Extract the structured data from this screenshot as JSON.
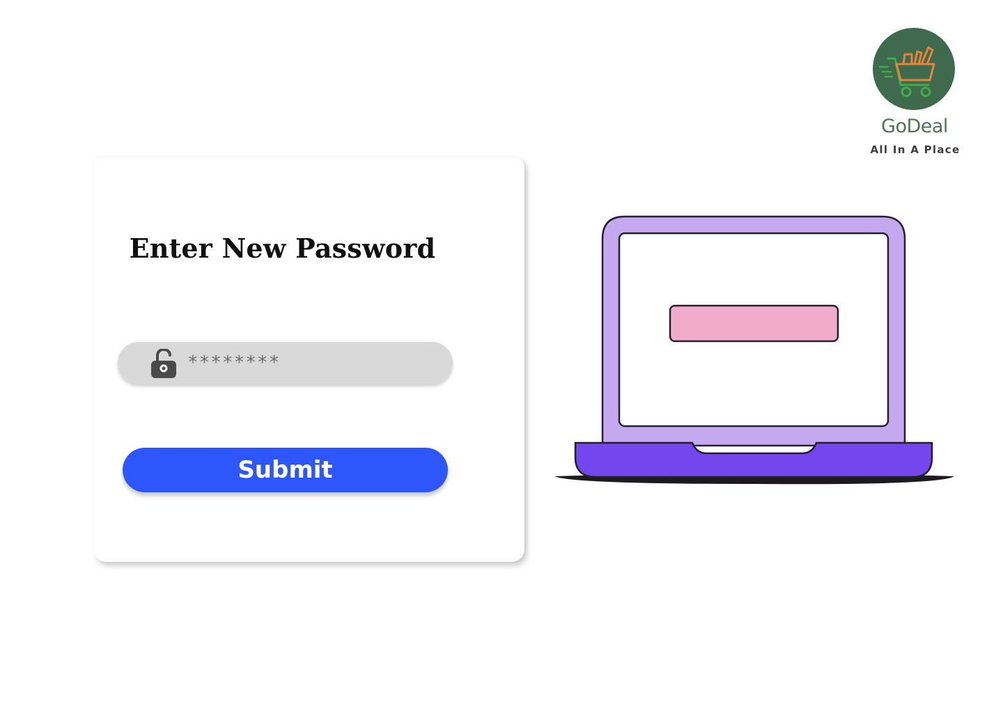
{
  "brand": {
    "name": "GoDeal",
    "tagline": "All In A Place",
    "logo_icon": "shopping-cart-icon",
    "circle_color": "#3f6a4d",
    "name_color": "#4b7555"
  },
  "form": {
    "title": "Enter New Password",
    "password": {
      "value": "********",
      "icon": "unlock-icon"
    },
    "submit_label": "Submit",
    "submit_color": "#2d56fc"
  },
  "illustration": {
    "icon": "laptop-illustration",
    "body_color": "#c4a9f0",
    "base_color": "#7447ee",
    "screen_bar_color": "#f1accb"
  }
}
